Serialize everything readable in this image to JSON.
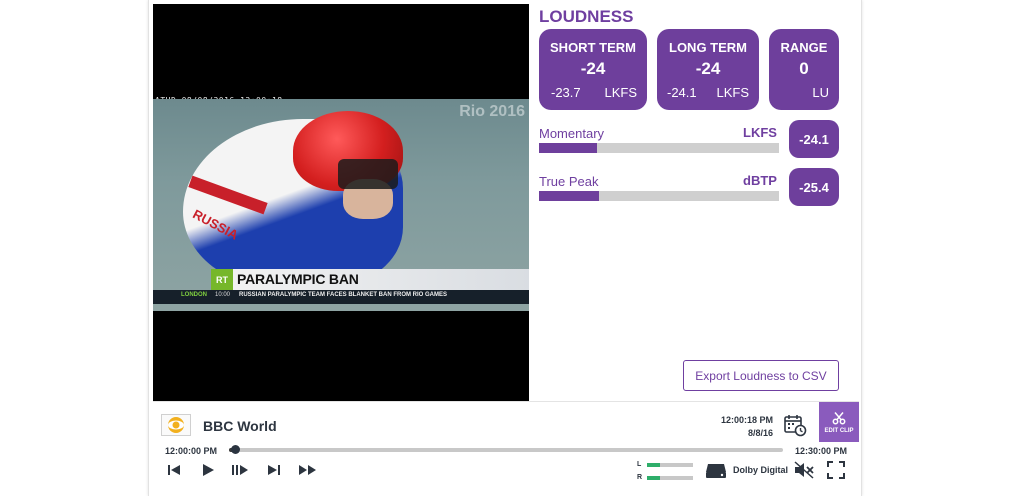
{
  "video": {
    "timestamp_overlay": "ATHD 08/08/2016 12:00:18",
    "bg_logo": "Rio 2016",
    "lower_third": {
      "brand": "RT",
      "title": "PARALYMPIC BAN",
      "location": "LONDON",
      "time": "10:00",
      "headline": "RUSSIAN PARALYMPIC TEAM FACES BLANKET BAN FROM RIO GAMES"
    },
    "jersey_text": "RUSSIA"
  },
  "loudness": {
    "title": "LOUDNESS",
    "cards": [
      {
        "label": "SHORT TERM",
        "value": "-24",
        "sub_value": "-23.7",
        "unit": "LKFS"
      },
      {
        "label": "LONG TERM",
        "value": "-24",
        "sub_value": "-24.1",
        "unit": "LKFS"
      },
      {
        "label": "RANGE",
        "value": "0",
        "sub_value": "",
        "unit": "LU"
      }
    ],
    "meters": [
      {
        "label": "Momentary",
        "unit": "LKFS",
        "value": "-24.1",
        "fill": 0.24
      },
      {
        "label": "True Peak",
        "unit": "dBTP",
        "value": "-25.4",
        "fill": 0.25
      }
    ],
    "export_label": "Export Loudness to CSV"
  },
  "player": {
    "channel_icon": "cbs-eye-icon",
    "channel_name": "BBC World",
    "clock_time": "12:00:18 PM",
    "clock_date": "8/8/16",
    "edit_clip_label": "EDIT CLIP",
    "timeline_start": "12:00:00 PM",
    "timeline_end": "12:30:00 PM",
    "progress": 0.01,
    "vu": {
      "left_label": "L",
      "right_label": "R",
      "left_level": 0.28,
      "right_level": 0.28
    },
    "audio_format": "Dolby Digital"
  },
  "colors": {
    "accent": "#6e3f9c",
    "accent_light": "#8a5bbd",
    "vu_green": "#2eae6a",
    "text_dark": "#2d3540"
  }
}
